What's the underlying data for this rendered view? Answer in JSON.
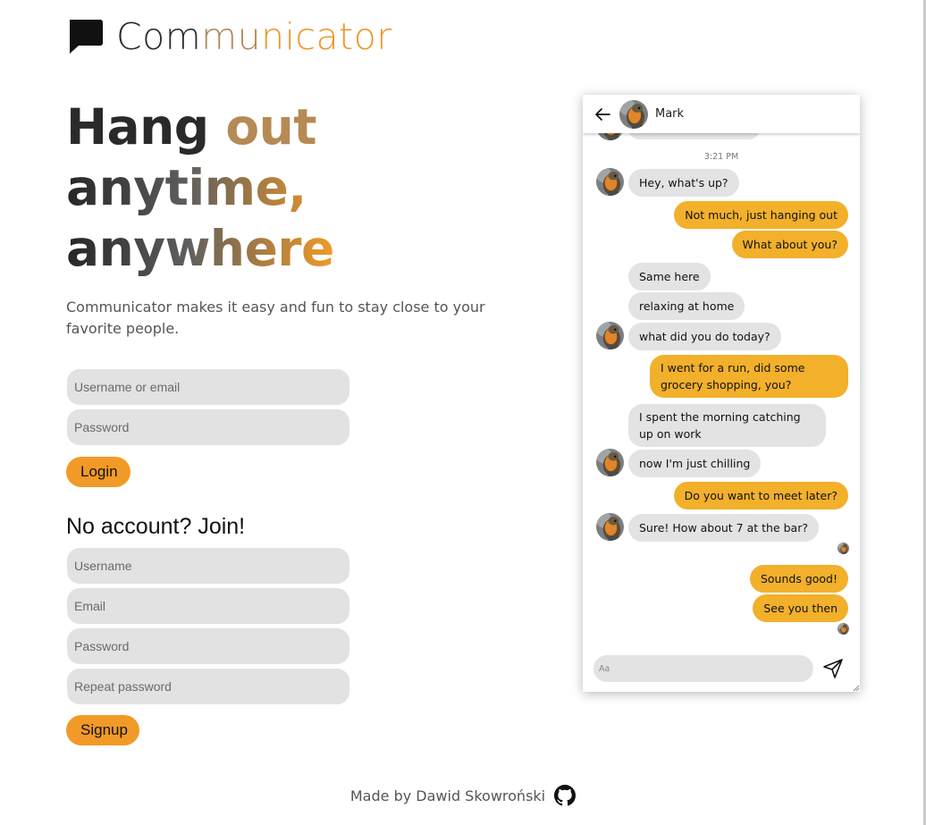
{
  "brand": {
    "name_part1": "Com",
    "name_part2": "mu",
    "name_part3": "nicator",
    "icon": "chat-bubble-icon"
  },
  "hero": {
    "line1_a": "Hang ",
    "line1_b": "out",
    "line2": "anytime,",
    "line3": "anywhere",
    "lead": "Communicator makes it easy and fun to stay close to your favorite people."
  },
  "login": {
    "username_placeholder": "Username or email",
    "password_placeholder": "Password",
    "button_label": "Login"
  },
  "signup": {
    "title": "No account? Join!",
    "username_placeholder": "Username",
    "email_placeholder": "Email",
    "password_placeholder": "Password",
    "repeat_placeholder": "Repeat password",
    "button_label": "Signup"
  },
  "footer": {
    "text": "Made by Dawid Skowroński",
    "icon": "github-icon"
  },
  "chat": {
    "contact_name": "Mark",
    "timestamp": "3:21 PM",
    "composer_placeholder": "Aa",
    "messages": [
      {
        "from": "them",
        "text": "Hey, what's up?"
      },
      {
        "from": "me",
        "text": "Not much, just hanging out"
      },
      {
        "from": "me",
        "text": "What about you?"
      },
      {
        "from": "them",
        "text": "Same here"
      },
      {
        "from": "them",
        "text": "relaxing at home"
      },
      {
        "from": "them",
        "text": "what did you do today?"
      },
      {
        "from": "me",
        "text": "I went for a run, did some grocery shopping, you?"
      },
      {
        "from": "them",
        "text": "I spent the morning catching up on work"
      },
      {
        "from": "them",
        "text": "now I'm just chilling"
      },
      {
        "from": "me",
        "text": "Do you want to meet later?"
      },
      {
        "from": "them",
        "text": "Sure! How about 7 at the bar?"
      },
      {
        "from": "me",
        "text": "Sounds good!"
      },
      {
        "from": "me",
        "text": "See you then"
      }
    ]
  },
  "colors": {
    "accent": "#f19a27",
    "outgoing_bubble": "#f2b02b",
    "incoming_bubble": "#e3e3e3",
    "field_bg": "#e2e2e2"
  }
}
